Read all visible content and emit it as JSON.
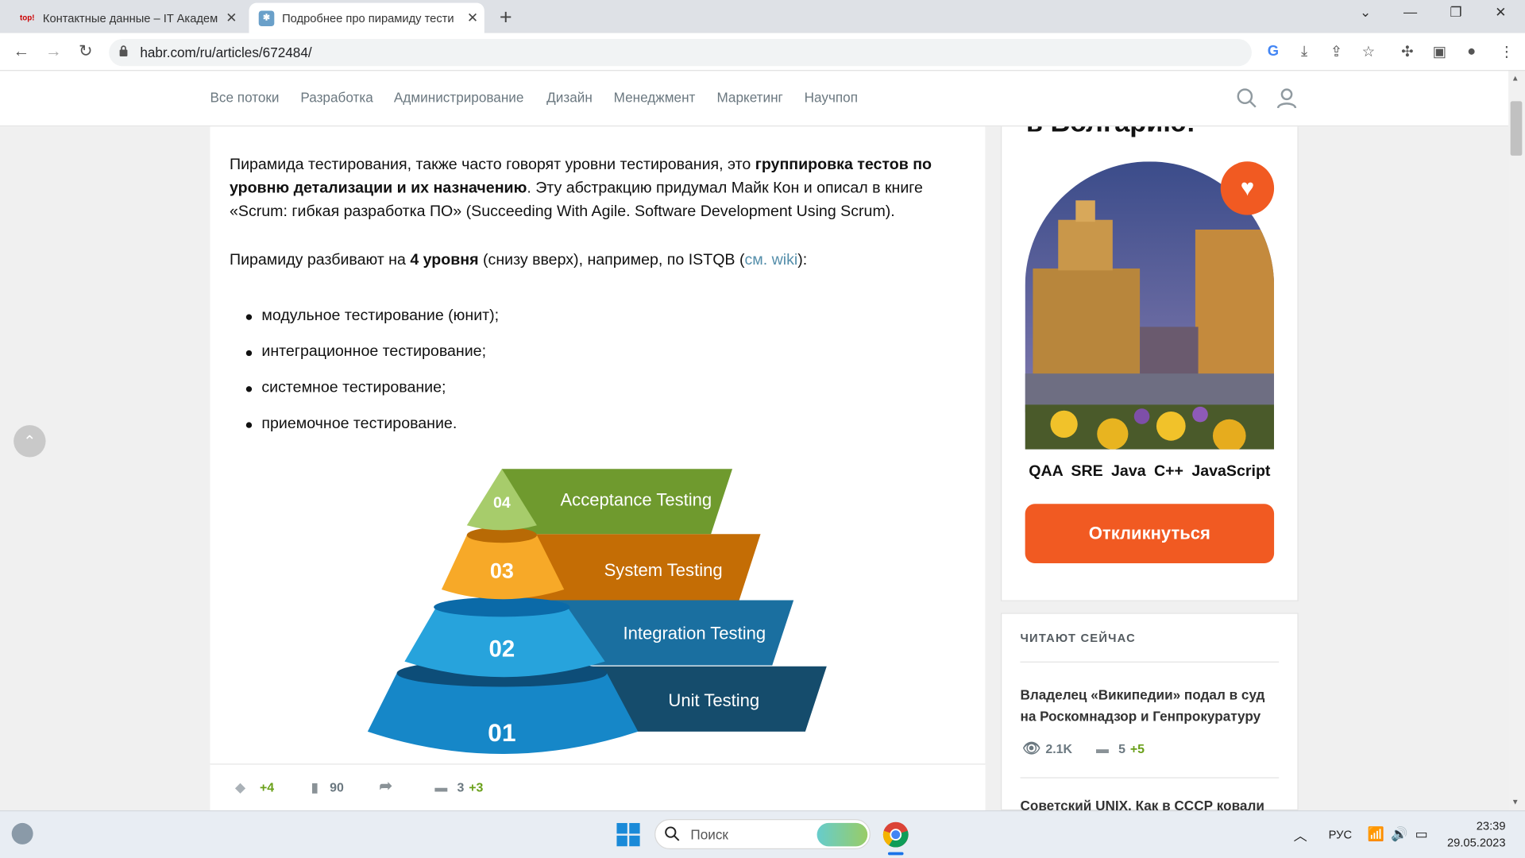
{
  "tabs": [
    {
      "favicon": "top!",
      "title": "Контактные данные – IT Академ",
      "close": "✕"
    },
    {
      "favicon": "✱",
      "title": "Подробнее про пирамиду тести",
      "close": "✕"
    }
  ],
  "new_tab": "+",
  "window_controls": [
    "⌄",
    "—",
    "❐",
    "✕"
  ],
  "address": {
    "url": "habr.com/ru/articles/672484/"
  },
  "toolbar_icons": [
    "google-icon",
    "download-icon",
    "share-icon",
    "star-icon",
    "extensions-icon",
    "sidepanel-icon",
    "profile-icon",
    "menu-icon"
  ],
  "habr_nav": [
    "Все потоки",
    "Разработка",
    "Администрирование",
    "Дизайн",
    "Менеджмент",
    "Маркетинг",
    "Научпоп"
  ],
  "article": {
    "p1_a": "Пирамида тестирования, также часто говорят уровни тестирования, это ",
    "p1_b": "группировка тестов по уровню детализации и их назначению",
    "p1_c": ". Эту абстракцию придумал Майк Кон и описал в книге «Scrum: гибкая разработка ПО» (Succeeding With Agile. Software Development Using Scrum).",
    "p2_a": "Пирамиду разбивают на ",
    "p2_b": "4 уровня",
    "p2_c": " (снизу вверх), например, по ISTQB (",
    "p2_link": "см. wiki",
    "p2_d": "):",
    "list": [
      "модульное тестирование (юнит);",
      "интеграционное тестирование;",
      "системное тестирование;",
      "приемочное тестирование."
    ],
    "pyramid": [
      {
        "num": "04",
        "label": "Acceptance Testing",
        "color": "#6f9a2e",
        "cone": "#a7cc6b"
      },
      {
        "num": "03",
        "label": "System Testing",
        "color": "#c46d05",
        "cone": "#f7a928"
      },
      {
        "num": "02",
        "label": "Integration Testing",
        "color": "#1a6fa0",
        "cone": "#27a3dc"
      },
      {
        "num": "01",
        "label": "Unit Testing",
        "color": "#154c6c",
        "cone": "#1687c8"
      }
    ]
  },
  "bottom_bar": {
    "rating": "+4",
    "bookmarks": "90",
    "comments": "3",
    "comments_new": "+3"
  },
  "sidebar": {
    "ad_title": "в Болгарию!",
    "ad_tags": "QAA SRE Java C++ JavaScript",
    "ad_button": "Откликнуться",
    "reading_header": "ЧИТАЮТ СЕЙЧАС",
    "posts": [
      {
        "title": "Владелец «Википедии» подал в суд на Роскомнадзор и Генпрокуратуру",
        "views": "2.1K",
        "comments": "5",
        "comments_new": "+5"
      },
      {
        "title": "Советский UNIX. Как в СССР ковали",
        "views": "",
        "comments": "",
        "comments_new": ""
      }
    ]
  },
  "taskbar": {
    "search_placeholder": "Поиск",
    "lang": "РУС",
    "time": "23:39",
    "date": "29.05.2023"
  },
  "colors": {
    "accent": "#f15a22",
    "link": "#548eaa",
    "rating_green": "#6aa01a"
  }
}
